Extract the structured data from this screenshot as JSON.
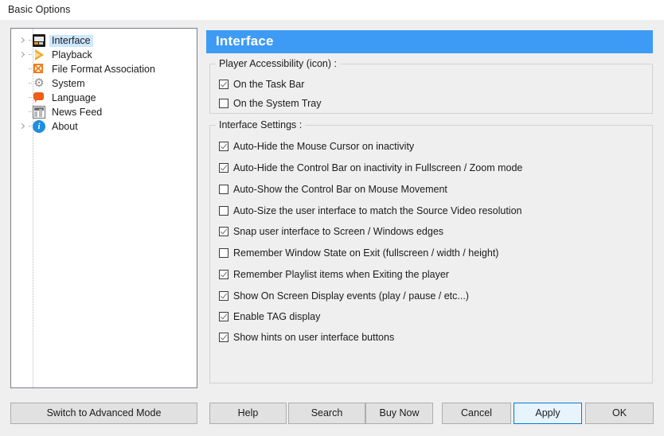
{
  "window": {
    "title": "Basic Options"
  },
  "sidebar": {
    "items": [
      {
        "label": "Interface",
        "icon": "film-strip-icon",
        "expandable": true,
        "selected": true
      },
      {
        "label": "Playback",
        "icon": "play-triangle-icon",
        "expandable": true,
        "selected": false
      },
      {
        "label": "File Format Association",
        "icon": "file-format-icon",
        "expandable": false,
        "selected": false
      },
      {
        "label": "System",
        "icon": "gear-icon",
        "expandable": false,
        "selected": false
      },
      {
        "label": "Language",
        "icon": "speech-bubble-icon",
        "expandable": false,
        "selected": false
      },
      {
        "label": "News Feed",
        "icon": "news-icon",
        "expandable": false,
        "selected": false
      },
      {
        "label": "About",
        "icon": "info-icon",
        "expandable": true,
        "selected": false
      }
    ]
  },
  "pane": {
    "header": "Interface",
    "header_color": "#3e9bf5",
    "groups": [
      {
        "legend": "Player Accessibility (icon) :",
        "options": [
          {
            "label": "On the Task Bar",
            "checked": true
          },
          {
            "label": "On the System Tray",
            "checked": false
          }
        ]
      },
      {
        "legend": "Interface Settings :",
        "options": [
          {
            "label": "Auto-Hide the Mouse Cursor on inactivity",
            "checked": true
          },
          {
            "label": "Auto-Hide the Control Bar on inactivity in Fullscreen / Zoom mode",
            "checked": true
          },
          {
            "label": "Auto-Show the Control Bar on Mouse Movement",
            "checked": false
          },
          {
            "label": "Auto-Size the user interface to match the Source Video resolution",
            "checked": false
          },
          {
            "label": "Snap user interface to Screen / Windows edges",
            "checked": true
          },
          {
            "label": "Remember Window State on Exit (fullscreen / width / height)",
            "checked": false
          },
          {
            "label": "Remember Playlist items when Exiting the player",
            "checked": true
          },
          {
            "label": "Show On Screen Display events (play / pause / etc...)",
            "checked": true
          },
          {
            "label": "Enable TAG display",
            "checked": true
          },
          {
            "label": "Show hints on user interface buttons",
            "checked": true
          }
        ]
      }
    ]
  },
  "buttons": {
    "advanced_mode": "Switch to Advanced Mode",
    "help": "Help",
    "search": "Search",
    "buy_now": "Buy Now",
    "cancel": "Cancel",
    "apply": "Apply",
    "ok": "OK",
    "focused": "apply",
    "focus_border_color": "#0078d7"
  }
}
